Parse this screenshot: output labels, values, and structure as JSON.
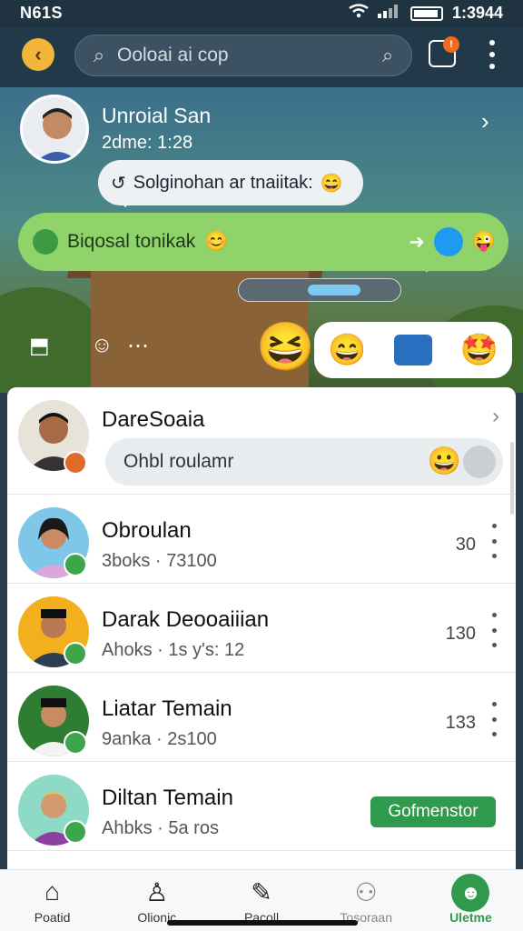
{
  "status_bar": {
    "time_left": "N61S",
    "time_right": "1:3944"
  },
  "search": {
    "placeholder": "Ooloai ai cop"
  },
  "notifications": {
    "badge": "!"
  },
  "hero": {
    "name": "Unroial San",
    "time": "2dme: 1:28",
    "bubble_white": "Solginohan ar tnaiitak:",
    "bubble_green": "Biqosal tonikak",
    "reactions": [
      "😄",
      "🙂",
      "🤩"
    ],
    "big_emoji": "😆",
    "progress": 0.6
  },
  "list": {
    "first": {
      "name": "DareSoaia",
      "input_placeholder": "Ohbl roulamr"
    },
    "rows": [
      {
        "name": "Obroulan",
        "sub": "3boks · 73100",
        "count": "30"
      },
      {
        "name": "Darak Deooaiiian",
        "sub": "Ahoks · 1s y's: 12",
        "count": "130"
      },
      {
        "name": "Liatar Temain",
        "sub": "9anka · 2s100",
        "count": "133"
      },
      {
        "name": "Diltan Temain",
        "sub": "Ahbks · 5a ros",
        "cta": "Gofmenstor"
      }
    ]
  },
  "bottom_nav": [
    {
      "label": "Poatid",
      "icon": "home-icon"
    },
    {
      "label": "Olionic",
      "icon": "person-icon"
    },
    {
      "label": "Pacoll",
      "icon": "edit-icon"
    },
    {
      "label": "Tosoraan",
      "icon": "people-icon"
    },
    {
      "label": "Uletme",
      "icon": "profile-icon"
    }
  ]
}
